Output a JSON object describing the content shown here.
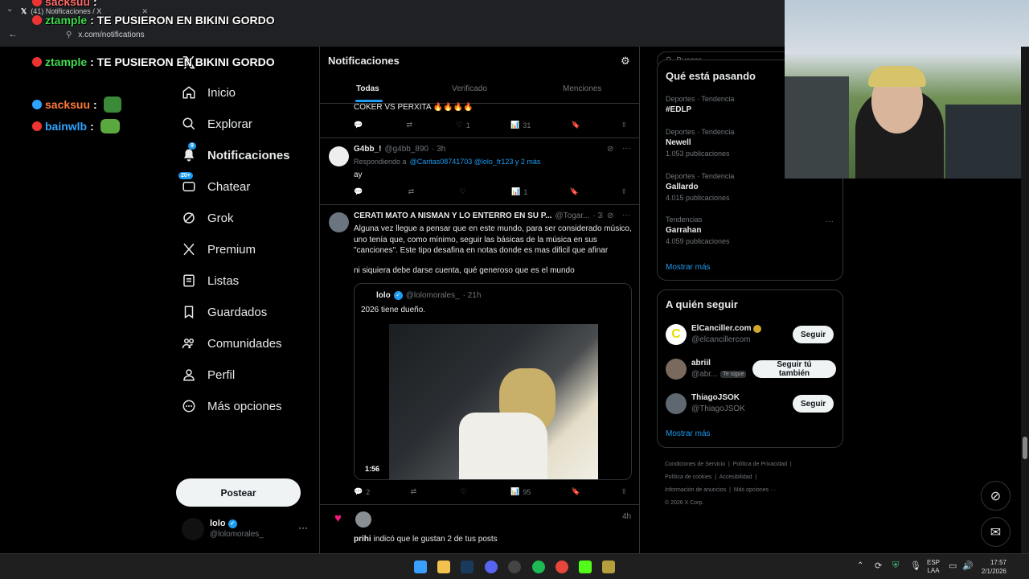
{
  "browser": {
    "tab_title": "(41) Notificaciones / X",
    "url": "x.com/notifications"
  },
  "chat_overlay": [
    {
      "user": "sacksuu",
      "text": ":",
      "color": "#ff6b6b"
    },
    {
      "user": "ztample",
      "text": ": TE PUSIERON EN BIKINI GORDO",
      "color": "#3fdc4f"
    },
    {
      "user": "ztample",
      "text": ": TE PUSIERON EN BIKINI GORDO",
      "color": "#3fdc4f"
    },
    {
      "user": "sacksuu",
      "text": ":",
      "color": "#ff7a3d"
    },
    {
      "user": "bainwlb",
      "text": ":",
      "color": "#2fa4ff"
    }
  ],
  "sidebar": {
    "items": [
      {
        "label": "Inicio",
        "icon": "home-icon"
      },
      {
        "label": "Explorar",
        "icon": "search-icon"
      },
      {
        "label": "Notificaciones",
        "icon": "bell-icon",
        "badge": "9"
      },
      {
        "label": "Chatear",
        "icon": "chat-icon",
        "badge": "20+"
      },
      {
        "label": "Grok",
        "icon": "grok-icon"
      },
      {
        "label": "Premium",
        "icon": "x-logo-icon"
      },
      {
        "label": "Listas",
        "icon": "list-icon"
      },
      {
        "label": "Guardados",
        "icon": "bookmark-icon"
      },
      {
        "label": "Comunidades",
        "icon": "communities-icon"
      },
      {
        "label": "Perfil",
        "icon": "person-icon"
      },
      {
        "label": "Más opciones",
        "icon": "more-circle-icon"
      }
    ],
    "post_label": "Postear",
    "account": {
      "name": "lolo",
      "handle": "@lolomorales_"
    }
  },
  "feed": {
    "title": "Notificaciones",
    "tabs": [
      "Todas",
      "Verificado",
      "Menciones"
    ],
    "active_tab": "Todas",
    "post1": {
      "text": "COKER VS PERXITA 🔥🔥🔥🔥",
      "replies": "",
      "reposts": "",
      "likes": "1",
      "views": "31"
    },
    "post2": {
      "name": "G4bb_!",
      "handle": "@g4bb_890",
      "time": "· 3h",
      "replying_prefix": "Respondiendo a",
      "replying_to": "@Caritas08741703 @lolo_fr123 y 2 más",
      "text": "ay",
      "replies": "",
      "reposts": "",
      "likes": "",
      "views": "1"
    },
    "post3": {
      "name": "CERATI MATO A NISMAN Y LO ENTERRO EN SU P...",
      "handle": "@Togar...",
      "time": "· 3h",
      "text": "Alguna vez llegue a pensar que en este mundo, para ser considerado músico, uno tenía que, como mínimo, seguir las básicas de la música en sus \"canciones\". Este tipo desafina en notas donde es mas dificil que afinar",
      "text2": "ni siquiera debe darse cuenta, qué generoso que es el mundo",
      "quote": {
        "name": "lolo",
        "handle": "@lolomorales_",
        "time": "· 21h",
        "text": "2026 tiene dueño.",
        "video_duration": "1:56"
      },
      "replies": "2",
      "reposts": "",
      "likes": "",
      "views": "95"
    },
    "like_notification": {
      "time": "4h",
      "user": "prihi",
      "text": "indicó que le gustan 2 de tus posts"
    }
  },
  "search": {
    "placeholder": "Buscar"
  },
  "trends": {
    "title": "Qué está pasando",
    "items": [
      {
        "context": "Deportes · Tendencia",
        "name": "#EDLP",
        "count": ""
      },
      {
        "context": "Deportes · Tendencia",
        "name": "Newell",
        "count": "1.053 publicaciones"
      },
      {
        "context": "Deportes · Tendencia",
        "name": "Gallardo",
        "count": "4.015 publicaciones"
      },
      {
        "context": "Tendencias",
        "name": "Garrahan",
        "count": "4.059 publicaciones"
      }
    ],
    "show_more": "Mostrar más"
  },
  "who_to_follow": {
    "title": "A quién seguir",
    "items": [
      {
        "name": "ElCanciller.com",
        "handle": "@elcancillercom",
        "button": "Seguir",
        "follows_you": ""
      },
      {
        "name": "abriil",
        "handle": "@abr...",
        "button": "Seguir tú también",
        "follows_you": "Te sigue"
      },
      {
        "name": "ThiagoJSOK",
        "handle": "@ThiagoJSOK",
        "button": "Seguir",
        "follows_you": ""
      }
    ],
    "show_more": "Mostrar más"
  },
  "footer": {
    "links": [
      "Condiciones de Servicio",
      "Política de Privacidad",
      "Política de cookies",
      "Accesibilidad",
      "Información de anuncios",
      "Más opciones ···"
    ],
    "copyright": "© 2026 X Corp."
  },
  "taskbar": {
    "lang": "ESP",
    "lang2": "LAA",
    "time": "17:57",
    "date": "2/1/2026"
  },
  "colors": {
    "accent": "#1d9bf0",
    "background": "#000000",
    "border": "#2f3336",
    "muted": "#71767b",
    "like_pink": "#f91880"
  }
}
